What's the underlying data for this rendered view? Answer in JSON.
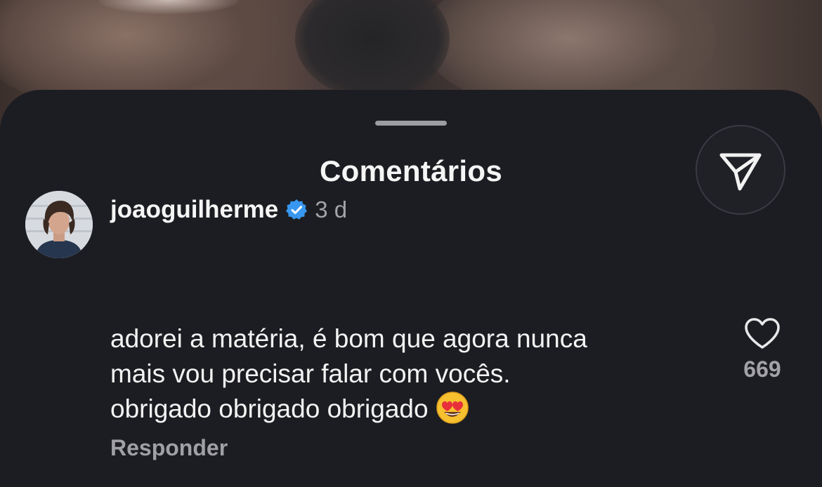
{
  "sheet": {
    "title": "Comentários"
  },
  "comment": {
    "username": "joaoguilherme",
    "verified": true,
    "time": "3 d",
    "lines": [
      "adorei a matéria, é bom que agora nunca",
      "mais vou precisar falar com vocês.",
      "obrigado obrigado obrigado"
    ],
    "emoji": "heart-eyes-emoji",
    "likes": "669",
    "reply_label": "Responder"
  },
  "colors": {
    "sheet_bg": "#1c1d22",
    "verified_blue": "#3897f0"
  }
}
